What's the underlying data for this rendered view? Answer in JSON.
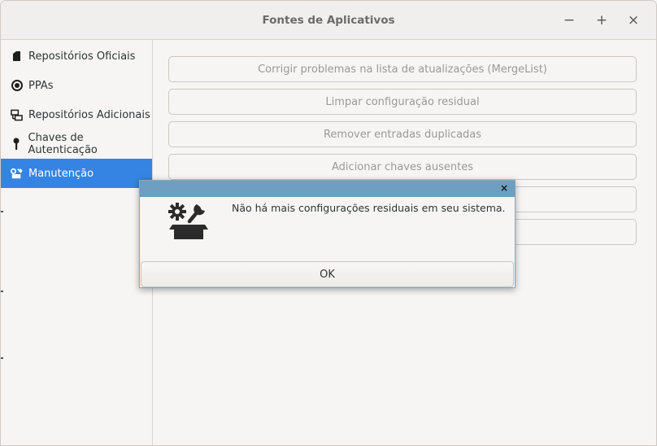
{
  "window": {
    "title": "Fontes de Aplicativos",
    "controls": {
      "minimize": "−",
      "maximize": "+",
      "close": "×"
    }
  },
  "sidebar": {
    "items": [
      {
        "label": "Repositórios Oficiais",
        "icon": "package-icon",
        "active": false
      },
      {
        "label": "PPAs",
        "icon": "target-icon",
        "active": false
      },
      {
        "label": "Repositórios Adicionais",
        "icon": "network-icon",
        "active": false
      },
      {
        "label": "Chaves de Autenticação",
        "icon": "key-icon",
        "active": false
      },
      {
        "label": "Manutenção",
        "icon": "tools-icon",
        "active": true
      }
    ],
    "accent": "#3584e4"
  },
  "main": {
    "buttons": [
      {
        "label": "Corrigir problemas na lista de atualizações (MergeList)"
      },
      {
        "label": "Limpar configuração residual"
      },
      {
        "label": "Remover entradas duplicadas"
      },
      {
        "label": "Adicionar chaves ausentes"
      },
      {
        "label": ""
      },
      {
        "label": ""
      }
    ]
  },
  "dialog": {
    "message": "Não há mais configurações residuais em seu sistema.",
    "ok_label": "OK",
    "close_label": "×",
    "icon": "maintenance-tools-icon",
    "header_color": "#6e9ec0"
  }
}
